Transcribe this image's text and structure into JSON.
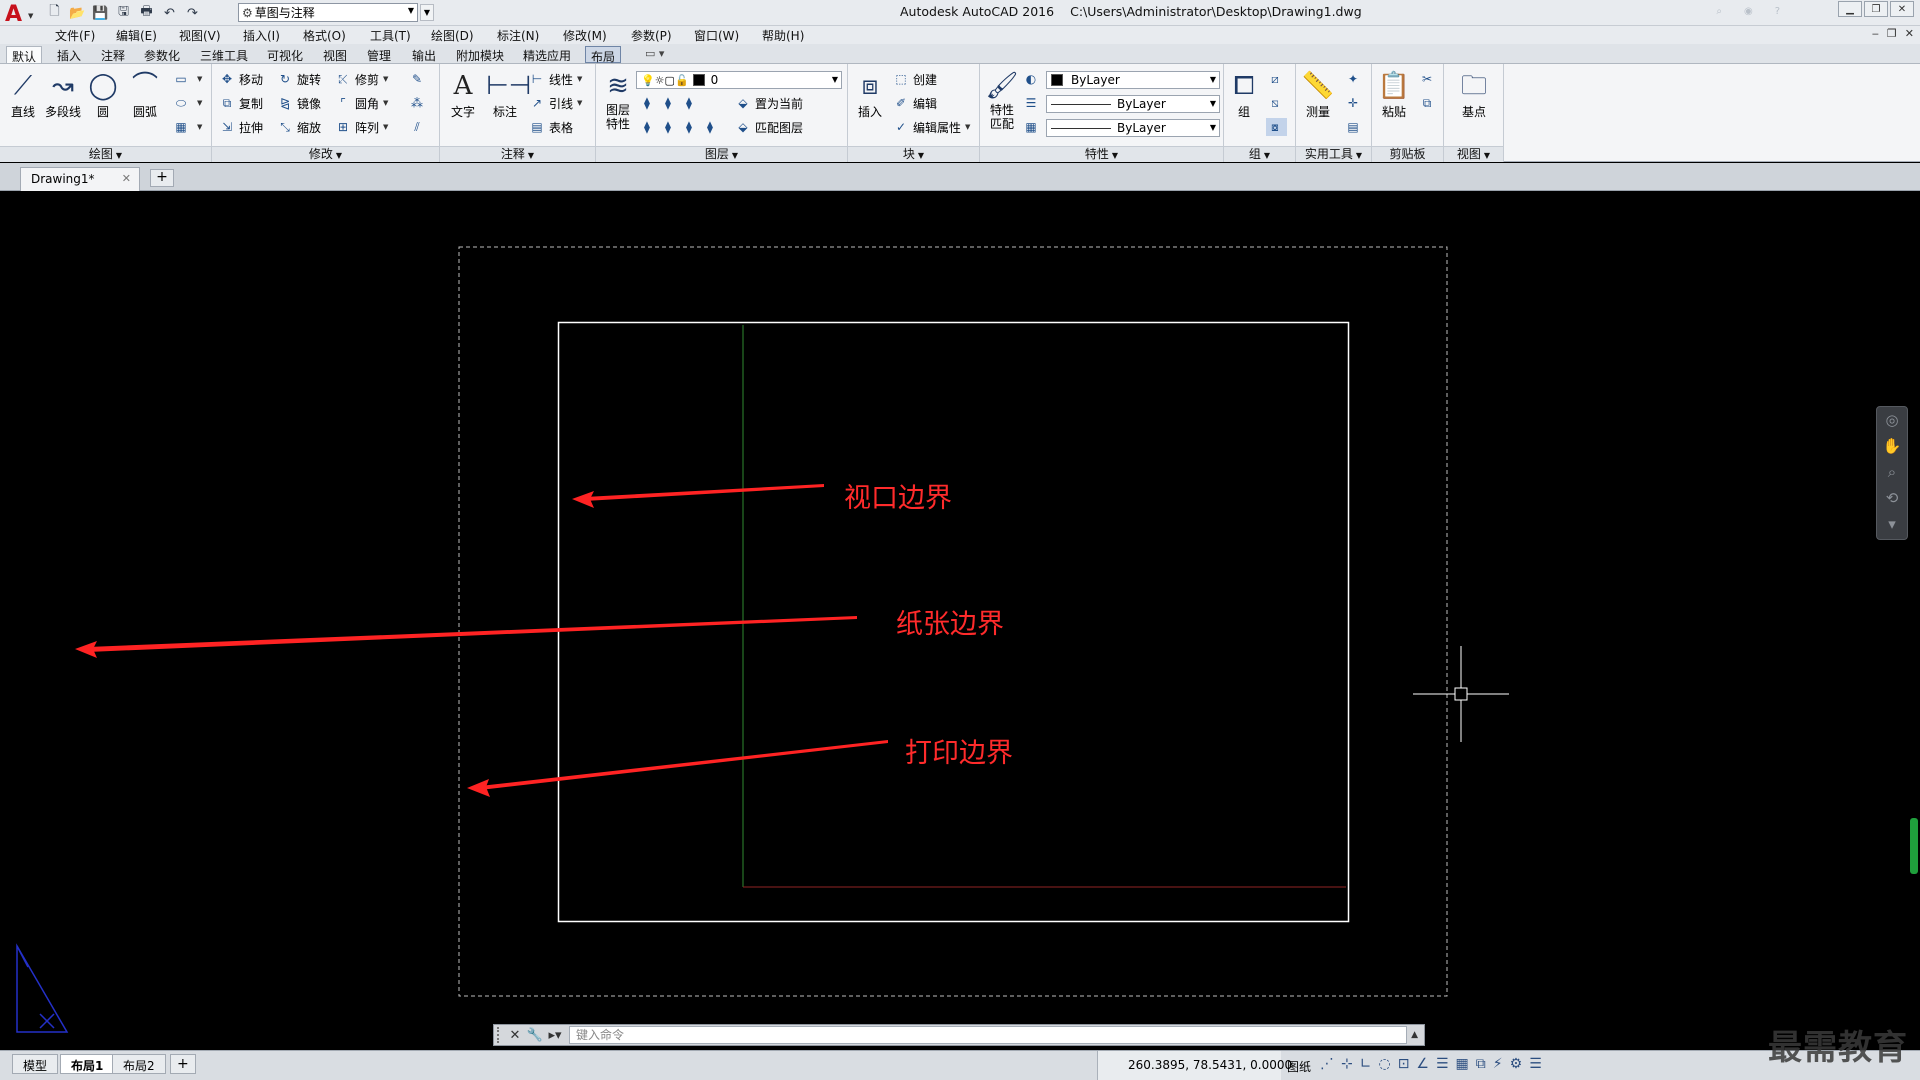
{
  "app": {
    "title": "Autodesk AutoCAD 2016",
    "file_path": "C:\\Users\\Administrator\\Desktop\\Drawing1.dwg",
    "workspace": "草图与注释"
  },
  "menus": [
    "文件(F)",
    "编辑(E)",
    "视图(V)",
    "插入(I)",
    "格式(O)",
    "工具(T)",
    "绘图(D)",
    "标注(N)",
    "修改(M)",
    "参数(P)",
    "窗口(W)",
    "帮助(H)"
  ],
  "ribbon_tabs": [
    "默认",
    "插入",
    "注释",
    "参数化",
    "三维工具",
    "可视化",
    "视图",
    "管理",
    "输出",
    "附加模块",
    "精选应用",
    "布局"
  ],
  "ribbon": {
    "draw": {
      "label": "绘图",
      "line": "直线",
      "polyline": "多段线",
      "circle": "圆",
      "arc": "圆弧"
    },
    "modify": {
      "label": "修改",
      "move": "移动",
      "rotate": "旋转",
      "trim": "修剪",
      "copy": "复制",
      "mirror": "镜像",
      "fillet": "圆角",
      "stretch": "拉伸",
      "scale": "缩放",
      "array": "阵列"
    },
    "annotation": {
      "label": "注释",
      "text": "文字",
      "dimension": "标注",
      "linear": "线性",
      "leader": "引线",
      "table": "表格"
    },
    "layers": {
      "label": "图层",
      "layer_props": "图层\n特性",
      "layer_name": "0",
      "set_current": "置为当前",
      "match_layer": "匹配图层"
    },
    "block": {
      "label": "块",
      "insert": "插入",
      "create": "创建",
      "edit": "编辑",
      "edit_attr": "编辑属性"
    },
    "properties": {
      "label": "特性",
      "match": "特性\n匹配",
      "color": "ByLayer",
      "linetype": "ByLayer",
      "lineweight": "ByLayer"
    },
    "groups": {
      "label": "组",
      "group": "组"
    },
    "utilities": {
      "label": "实用工具",
      "measure": "测量"
    },
    "clipboard": {
      "label": "剪贴板",
      "paste": "粘贴"
    },
    "view": {
      "label": "视图",
      "base": "基点"
    }
  },
  "file_tab": {
    "name": "Drawing1*"
  },
  "annotations": {
    "viewport": "视口边界",
    "paper": "纸张边界",
    "print": "打印边界"
  },
  "command": {
    "placeholder": "键入命令"
  },
  "layout_tabs": [
    "模型",
    "布局1",
    "布局2"
  ],
  "status": {
    "coordinates": "260.3895, 78.5431, 0.0000",
    "space": "图纸"
  },
  "watermark": "最需教育",
  "colors": {
    "annotation": "#ff2b2b",
    "canvas": "#000000",
    "logo": "#c7111c"
  }
}
